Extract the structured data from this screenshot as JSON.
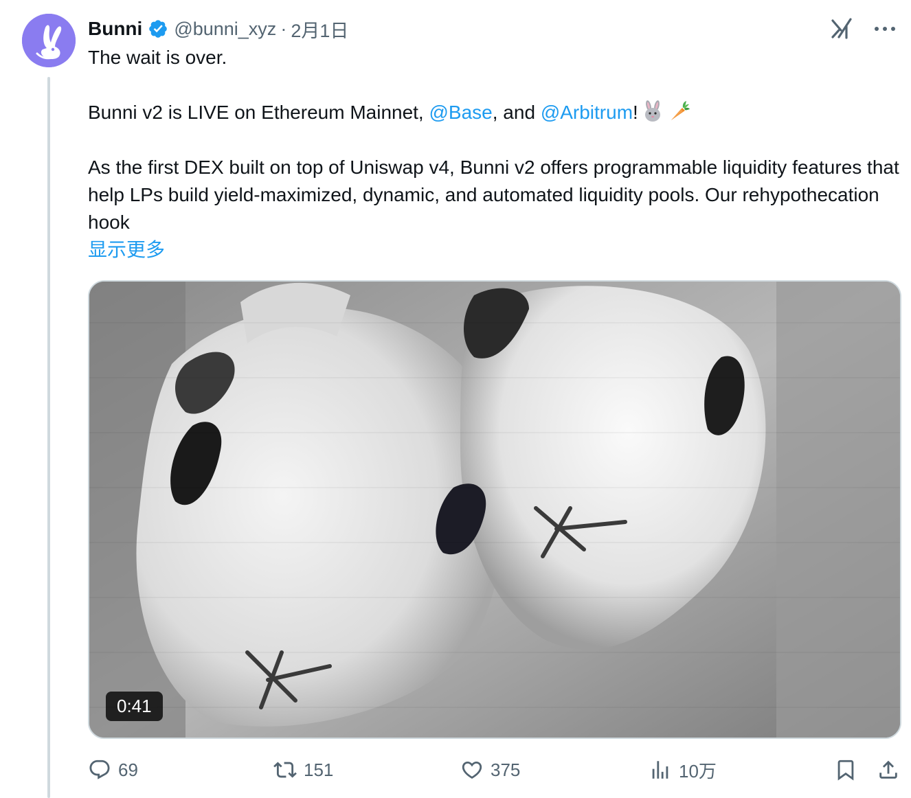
{
  "author": {
    "display_name": "Bunni",
    "handle": "@bunni_xyz",
    "separator": "·",
    "date": "2月1日",
    "verified_icon": "verified-badge-icon",
    "avatar_color": "#8a7cf0"
  },
  "tweet": {
    "line1": "The wait is over.",
    "line2_a": "Bunni v2 is LIVE on Ethereum Mainnet, ",
    "mention_base": "@Base",
    "line2_b": ", and ",
    "mention_arbitrum": "@Arbitrum",
    "line2_c": "!",
    "emoji_1": "rabbit-face-icon",
    "emoji_2": "carrot-icon",
    "line3": "As the first DEX built on top of Uniswap v4, Bunni v2 offers programmable liquidity features that help LPs build yield-maximized, dynamic, and automated liquidity pools. Our rehypothecation hook",
    "show_more": "显示更多"
  },
  "media": {
    "duration": "0:41"
  },
  "actions": {
    "replies": "69",
    "reposts": "151",
    "likes": "375",
    "views": "10万"
  },
  "colors": {
    "accent": "#1d9bf0",
    "secondary_text": "#536471",
    "thread_line": "#cfd9de"
  }
}
